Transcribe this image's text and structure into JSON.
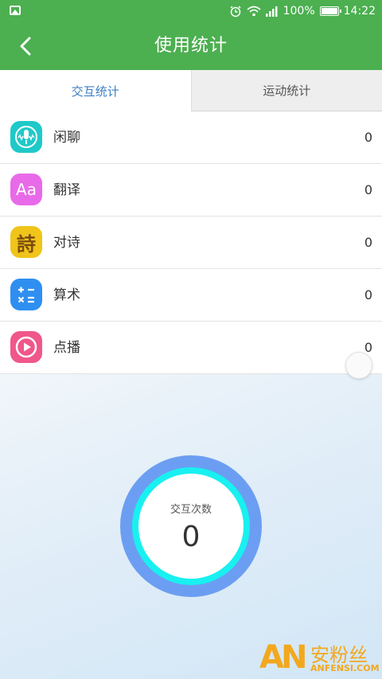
{
  "status_bar": {
    "battery": "100%",
    "time": "14:22"
  },
  "header": {
    "title": "使用统计"
  },
  "tabs": [
    {
      "label": "交互统计",
      "active": true
    },
    {
      "label": "运动统计",
      "active": false
    }
  ],
  "items": [
    {
      "label": "闲聊",
      "count": "0",
      "icon": "voice-icon",
      "color": "#1fc9c9"
    },
    {
      "label": "翻译",
      "count": "0",
      "icon": "translate-icon",
      "color": "#e86ae8",
      "glyph": "Aa"
    },
    {
      "label": "对诗",
      "count": "0",
      "icon": "poem-icon",
      "color": "#f0c419",
      "glyph": "詩"
    },
    {
      "label": "算术",
      "count": "0",
      "icon": "calculator-icon",
      "color": "#2f8ff0"
    },
    {
      "label": "点播",
      "count": "0",
      "icon": "play-icon",
      "color": "#f0578a"
    }
  ],
  "summary": {
    "caption": "交互次数",
    "value": "0"
  },
  "watermark": {
    "logo": "AN",
    "name": "安粉丝",
    "domain": "ANFENSI.COM"
  }
}
